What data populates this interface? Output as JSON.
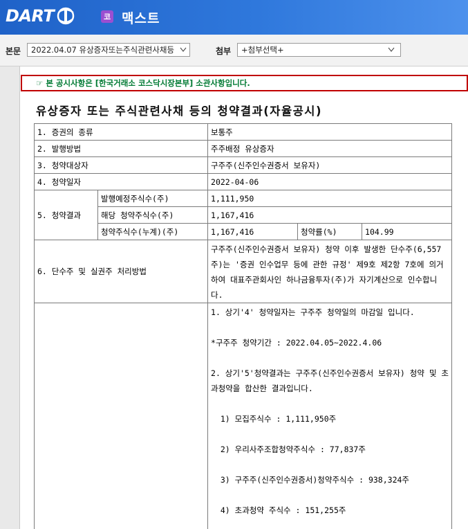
{
  "header": {
    "logo": "DART",
    "company_badge": "코",
    "company_name": "맥스트"
  },
  "toolbar": {
    "main_label": "본문",
    "main_select": "2022.04.07  유상증자또는주식관련사채등",
    "attach_label": "첨부",
    "attach_select": "+첨부선택+"
  },
  "notice": "본 공시사항은 [한국거래소 코스닥시장본부] 소관사항입니다.",
  "doc_title": "유상증자 또는 주식관련사채 등의 청약결과(자율공시)",
  "rows": {
    "r1": {
      "label": "1. 증권의 종류",
      "value": "보통주"
    },
    "r2": {
      "label": "2. 발행방법",
      "value": "주주배정 유상증자"
    },
    "r3": {
      "label": "3. 청약대상자",
      "value": "구주주(신주인수권증서 보유자)"
    },
    "r4": {
      "label": "4. 청약일자",
      "value": "2022-04-06"
    },
    "r5": {
      "label": "5. 청약결과",
      "planned_label": "발행예정주식수(주)",
      "planned_value": "1,111,950",
      "subscribed_label": "해당 청약주식수(주)",
      "subscribed_value": "1,167,416",
      "cumulative_label": "청약주식수(누계)(주)",
      "cumulative_value": "1,167,416",
      "rate_label": "청약률(%)",
      "rate_value": "104.99"
    },
    "r6": {
      "label": "6. 단수주 및 실권주 처리방법",
      "value": "구주주(신주인수권증서 보유자) 청약 이후 발생한 단수주(6,557주)는 '증권 인수업무 등에 관한 규정' 제9호 제2항 7호에 의거하여 대표주관회사인 하나금융투자(주)가 자기계산으로 인수합니다."
    },
    "r7": {
      "lines": [
        "1. 상기'4' 청약일자는 구주주 청약일의 마감일 입니다.",
        "",
        "*구주주 청약기간 : 2022.04.05~2022.4.06",
        "",
        "2. 상기'5'청약결과는 구주주(신주인수권증서 보유자) 청약 및 초과청약을 합산한 결과입니다.",
        "",
        "  1) 모집주식수 : 1,111,950주",
        "",
        "  2) 우리사주조합청약주식수 : 77,837주",
        "",
        "  3) 구주주(신주인수권증서)청약주식수 : 938,324주",
        "",
        "  4) 초과청약 주식수 : 151,255주"
      ]
    }
  },
  "colors": {
    "header_blue": "#1f62c8",
    "notice_border": "#c00000",
    "notice_text": "#007a33",
    "badge": "#9b4fd1"
  }
}
